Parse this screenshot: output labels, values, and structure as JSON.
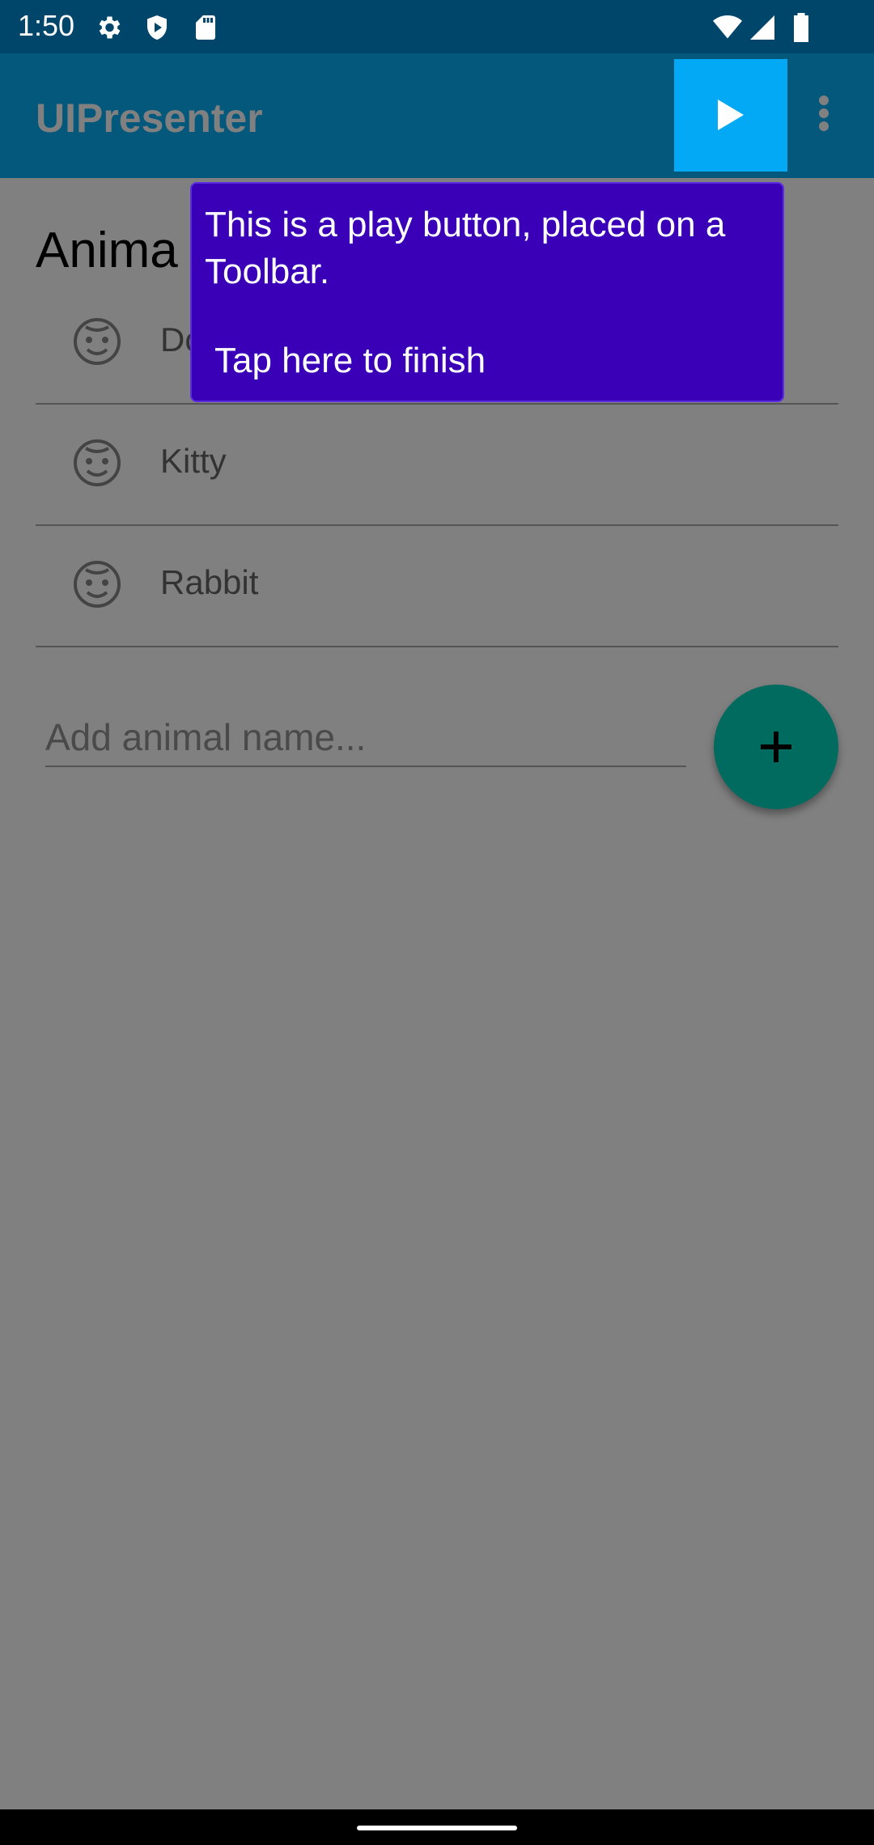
{
  "status_bar": {
    "time": "1:50",
    "left_icons": [
      "gear-icon",
      "shield-icon",
      "sd-card-icon"
    ],
    "right_icons": [
      "wifi-icon",
      "signal-icon",
      "battery-icon"
    ]
  },
  "toolbar": {
    "title": "UIPresenter",
    "play_icon": "play-icon",
    "overflow_icon": "more-vert-icon",
    "color": "#03587c",
    "play_highlight_color": "#03a9f4"
  },
  "section": {
    "title": "Anima"
  },
  "animals": [
    {
      "label": "Do",
      "icon": "face-icon"
    },
    {
      "label": "Kitty",
      "icon": "face-icon"
    },
    {
      "label": "Rabbit",
      "icon": "face-icon"
    }
  ],
  "add_input": {
    "placeholder": "Add animal name...",
    "value": ""
  },
  "fab": {
    "icon": "add-icon",
    "color": "#016b60"
  },
  "tooltip": {
    "text": "This is a play button, placed on a Toolbar.",
    "finish": "Tap here to finish",
    "color": "#3a00b8"
  }
}
